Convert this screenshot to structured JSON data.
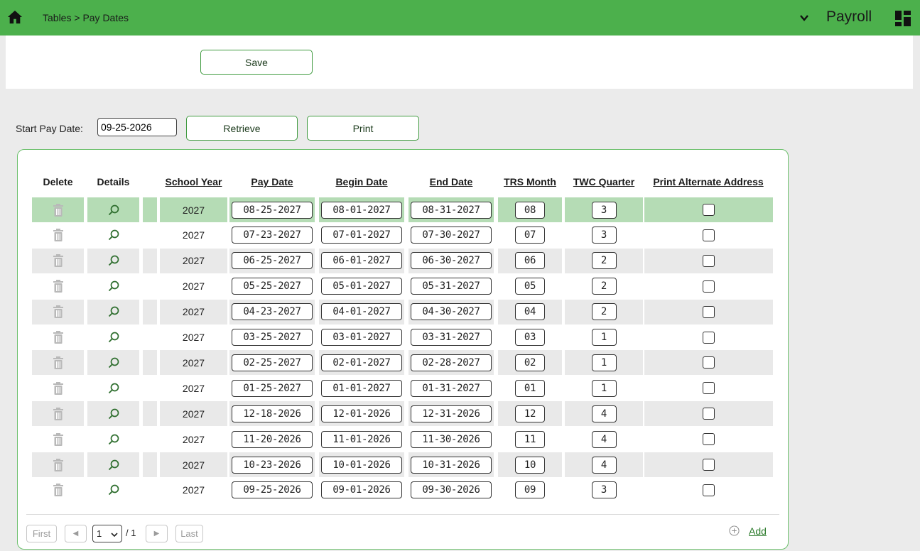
{
  "header": {
    "breadcrumb_root": "Tables",
    "breadcrumb_sep": ">",
    "breadcrumb_page": "Pay Dates",
    "module": "Payroll",
    "accent_color": "#4cb04c"
  },
  "toolbar": {
    "save_label": "Save"
  },
  "filter": {
    "start_label": "Start Pay Date:",
    "start_value": "09-25-2026",
    "retrieve_label": "Retrieve",
    "print_label": "Print"
  },
  "table": {
    "columns": {
      "delete": "Delete",
      "details": "Details",
      "school_year": "School Year",
      "pay_date": "Pay Date",
      "begin_date": "Begin Date",
      "end_date": "End Date",
      "trs_month": "TRS Month",
      "twc_quarter": "TWC Quarter",
      "print_alt": "Print Alternate Address"
    },
    "rows": [
      {
        "school_year": "2027",
        "pay_date": "08-25-2027",
        "begin_date": "08-01-2027",
        "end_date": "08-31-2027",
        "trs_month": "08",
        "twc_quarter": "3",
        "print_alt": false
      },
      {
        "school_year": "2027",
        "pay_date": "07-23-2027",
        "begin_date": "07-01-2027",
        "end_date": "07-30-2027",
        "trs_month": "07",
        "twc_quarter": "3",
        "print_alt": false
      },
      {
        "school_year": "2027",
        "pay_date": "06-25-2027",
        "begin_date": "06-01-2027",
        "end_date": "06-30-2027",
        "trs_month": "06",
        "twc_quarter": "2",
        "print_alt": false
      },
      {
        "school_year": "2027",
        "pay_date": "05-25-2027",
        "begin_date": "05-01-2027",
        "end_date": "05-31-2027",
        "trs_month": "05",
        "twc_quarter": "2",
        "print_alt": false
      },
      {
        "school_year": "2027",
        "pay_date": "04-23-2027",
        "begin_date": "04-01-2027",
        "end_date": "04-30-2027",
        "trs_month": "04",
        "twc_quarter": "2",
        "print_alt": false
      },
      {
        "school_year": "2027",
        "pay_date": "03-25-2027",
        "begin_date": "03-01-2027",
        "end_date": "03-31-2027",
        "trs_month": "03",
        "twc_quarter": "1",
        "print_alt": false
      },
      {
        "school_year": "2027",
        "pay_date": "02-25-2027",
        "begin_date": "02-01-2027",
        "end_date": "02-28-2027",
        "trs_month": "02",
        "twc_quarter": "1",
        "print_alt": false
      },
      {
        "school_year": "2027",
        "pay_date": "01-25-2027",
        "begin_date": "01-01-2027",
        "end_date": "01-31-2027",
        "trs_month": "01",
        "twc_quarter": "1",
        "print_alt": false
      },
      {
        "school_year": "2027",
        "pay_date": "12-18-2026",
        "begin_date": "12-01-2026",
        "end_date": "12-31-2026",
        "trs_month": "12",
        "twc_quarter": "4",
        "print_alt": false
      },
      {
        "school_year": "2027",
        "pay_date": "11-20-2026",
        "begin_date": "11-01-2026",
        "end_date": "11-30-2026",
        "trs_month": "11",
        "twc_quarter": "4",
        "print_alt": false
      },
      {
        "school_year": "2027",
        "pay_date": "10-23-2026",
        "begin_date": "10-01-2026",
        "end_date": "10-31-2026",
        "trs_month": "10",
        "twc_quarter": "4",
        "print_alt": false
      },
      {
        "school_year": "2027",
        "pay_date": "09-25-2026",
        "begin_date": "09-01-2026",
        "end_date": "09-30-2026",
        "trs_month": "09",
        "twc_quarter": "3",
        "print_alt": false
      }
    ],
    "icons": {
      "delete": "trash-icon",
      "details": "magnifier-icon"
    }
  },
  "pager": {
    "first": "First",
    "prev": "◀",
    "page": "1",
    "total": "/ 1",
    "next": "▶",
    "last": "Last",
    "add_label": "Add"
  }
}
